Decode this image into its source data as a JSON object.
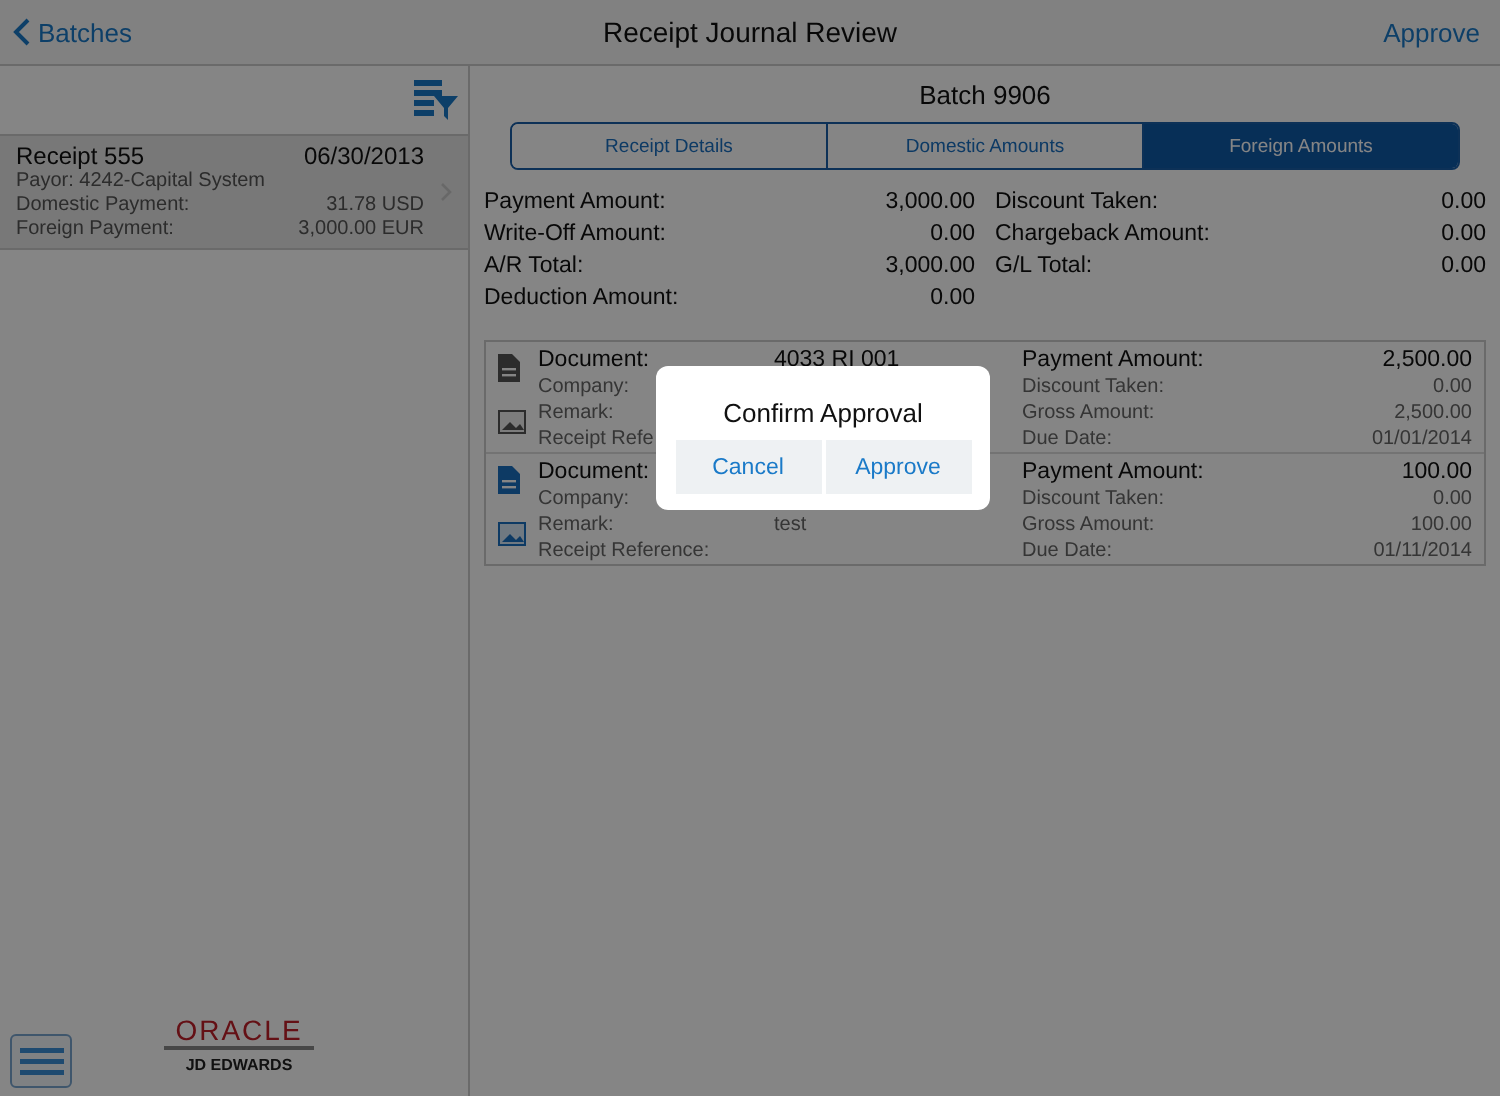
{
  "nav": {
    "back": "Batches",
    "title": "Receipt Journal Review",
    "action": "Approve"
  },
  "receipts": [
    {
      "title": "Receipt 555",
      "date": "06/30/2013",
      "selected": true,
      "lines": [
        {
          "label": "Payor: 4242-Capital System"
        },
        {
          "label": "Domestic Payment:",
          "value": "31.78 USD"
        },
        {
          "label": "Foreign Payment:",
          "value": "3,000.00 EUR"
        }
      ]
    }
  ],
  "batch": "Batch 9906",
  "tabs": [
    {
      "label": "Receipt Details",
      "selected": false
    },
    {
      "label": "Domestic Amounts",
      "selected": false
    },
    {
      "label": "Foreign Amounts",
      "selected": true
    }
  ],
  "summary": [
    {
      "label": "Payment Amount:",
      "value": "3,000.00"
    },
    {
      "label": "Discount Taken:",
      "value": "0.00"
    },
    {
      "label": "Write-Off Amount:",
      "value": "0.00"
    },
    {
      "label": "Chargeback Amount:",
      "value": "0.00"
    },
    {
      "label": "A/R Total:",
      "value": "3,000.00"
    },
    {
      "label": "G/L Total:",
      "value": "0.00"
    },
    {
      "label": "Deduction Amount:",
      "value": "0.00"
    }
  ],
  "documents": [
    {
      "attached": false,
      "left": [
        {
          "label": "Document:",
          "value": "4033 RI 001"
        },
        {
          "label": "Company:"
        },
        {
          "label": "Remark:"
        },
        {
          "label": "Receipt Refe"
        }
      ],
      "right": [
        {
          "label": "Payment Amount:",
          "value": "2,500.00"
        },
        {
          "label": "Discount Taken:",
          "value": "0.00"
        },
        {
          "label": "Gross Amount:",
          "value": "2,500.00"
        },
        {
          "label": "Due Date:",
          "value": "01/01/2014"
        }
      ]
    },
    {
      "attached": true,
      "left": [
        {
          "label": "Document:"
        },
        {
          "label": "Company:"
        },
        {
          "label": "Remark:",
          "value": "test"
        },
        {
          "label": "Receipt Reference:"
        }
      ],
      "right": [
        {
          "label": "Payment Amount:",
          "value": "100.00"
        },
        {
          "label": "Discount Taken:",
          "value": "0.00"
        },
        {
          "label": "Gross Amount:",
          "value": "100.00"
        },
        {
          "label": "Due Date:",
          "value": "01/11/2014"
        }
      ]
    }
  ],
  "logo": {
    "brand": "ORACLE",
    "sub": "JD EDWARDS"
  },
  "dialog": {
    "title": "Confirm Approval",
    "buttons": [
      "Cancel",
      "Approve"
    ]
  }
}
